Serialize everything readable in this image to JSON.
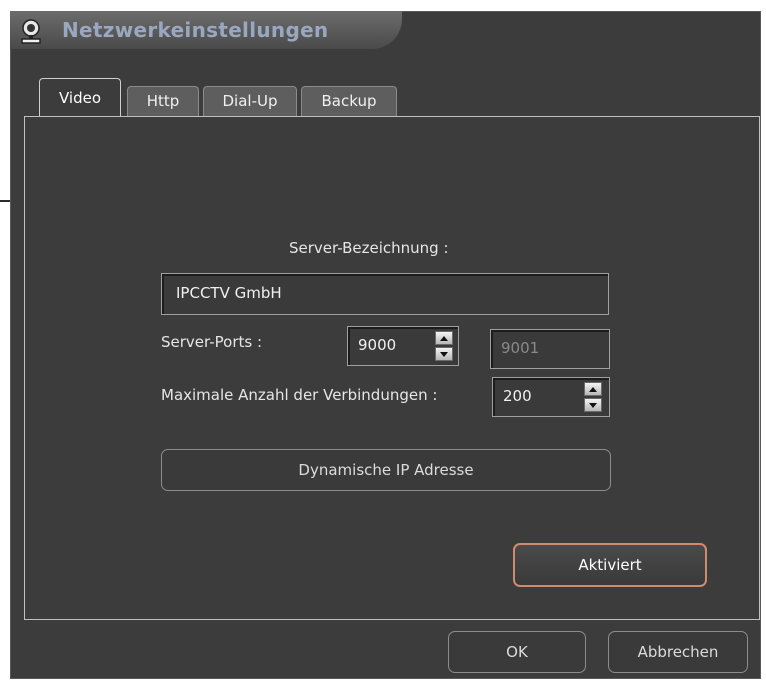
{
  "window": {
    "title": "Netzwerkeinstellungen",
    "title_icon": "network-camera-icon"
  },
  "tabs": [
    {
      "label": "Video",
      "active": true
    },
    {
      "label": "Http",
      "active": false
    },
    {
      "label": "Dial-Up",
      "active": false
    },
    {
      "label": "Backup",
      "active": false
    }
  ],
  "video": {
    "server_name_label": "Server-Bezeichnung :",
    "server_name_value": "IPCCTV  GmbH",
    "server_ports_label": "Server-Ports :",
    "server_port_value": "9000",
    "server_port_secondary_value": "9001",
    "max_connections_label": "Maximale Anzahl der Verbindungen :",
    "max_connections_value": "200",
    "dynamic_ip_label": "Dynamische IP Adresse",
    "activated_label": "Aktiviert"
  },
  "footer": {
    "ok_label": "OK",
    "cancel_label": "Abbrechen"
  },
  "colors": {
    "window_bg": "#3c3c3c",
    "title_text": "#9aa7c0",
    "accent_border": "#d08a6c"
  }
}
